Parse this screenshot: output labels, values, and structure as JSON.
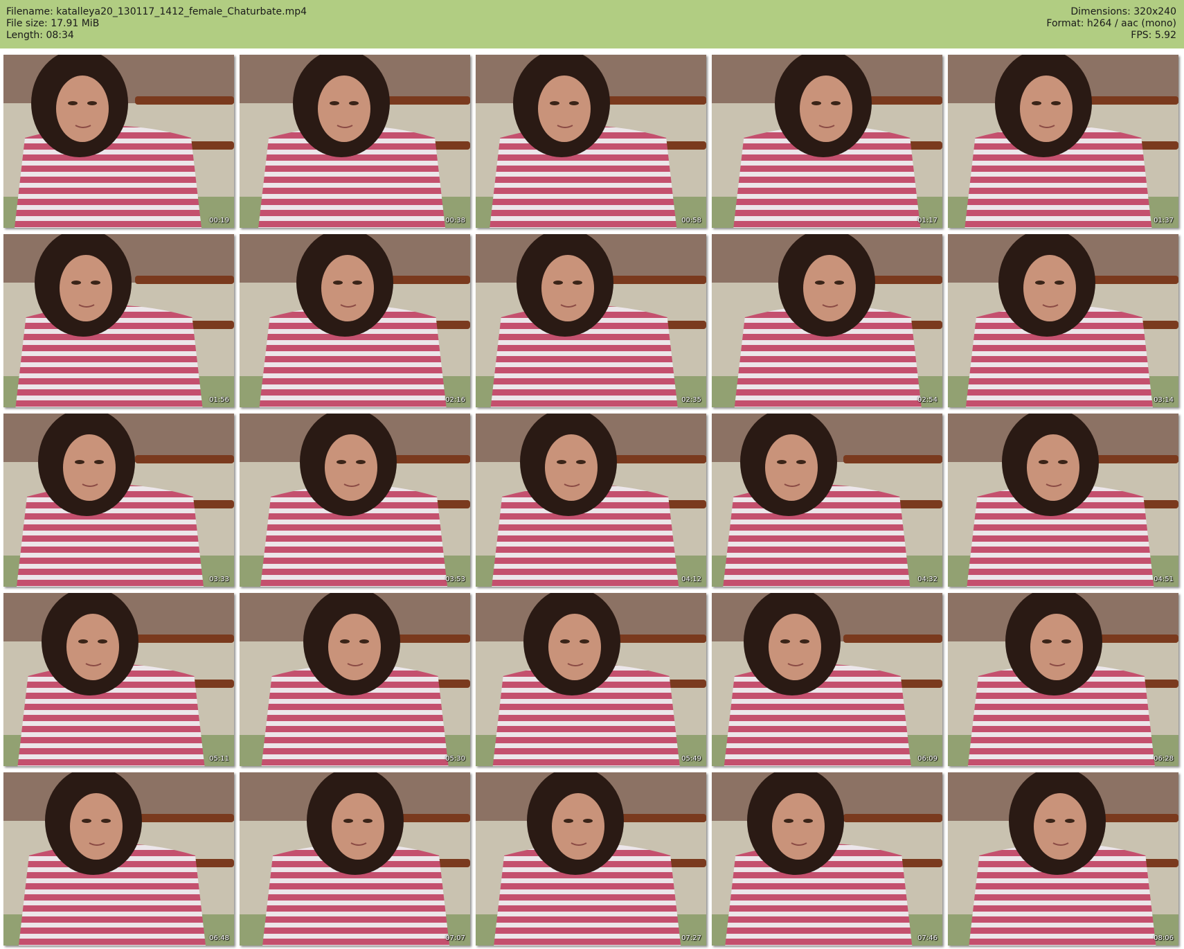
{
  "file_info": {
    "filename_line": "Filename: katalleya20_130117_1412_female_Chaturbate.mp4",
    "filesize_line": "File size: 17.91 MiB",
    "length_line": "Length: 08:34",
    "dimensions_line": "Dimensions: 320x240",
    "format_line": "Format: h264 / aac (mono)",
    "fps_line": "FPS: 5.92"
  },
  "colors": {
    "header_bg": "#b1cd82",
    "wall": "#c9c2b0",
    "shelf": "#7a3a1e",
    "stripe_pink": "#c4506e",
    "stripe_white": "#ece6ea",
    "hair": "#2a1a14",
    "skin": "#c9937a"
  },
  "thumbnails": [
    {
      "timestamp": "00:19"
    },
    {
      "timestamp": "00:38"
    },
    {
      "timestamp": "00:58"
    },
    {
      "timestamp": "01:17"
    },
    {
      "timestamp": "01:37"
    },
    {
      "timestamp": "01:56"
    },
    {
      "timestamp": "02:16"
    },
    {
      "timestamp": "02:35"
    },
    {
      "timestamp": "02:54"
    },
    {
      "timestamp": "03:14"
    },
    {
      "timestamp": "03:33"
    },
    {
      "timestamp": "03:53"
    },
    {
      "timestamp": "04:12"
    },
    {
      "timestamp": "04:32"
    },
    {
      "timestamp": "04:51"
    },
    {
      "timestamp": "05:11"
    },
    {
      "timestamp": "05:30"
    },
    {
      "timestamp": "05:49"
    },
    {
      "timestamp": "06:09"
    },
    {
      "timestamp": "06:28"
    },
    {
      "timestamp": "06:48"
    },
    {
      "timestamp": "07:07"
    },
    {
      "timestamp": "07:27"
    },
    {
      "timestamp": "07:46"
    },
    {
      "timestamp": "08:06"
    }
  ]
}
